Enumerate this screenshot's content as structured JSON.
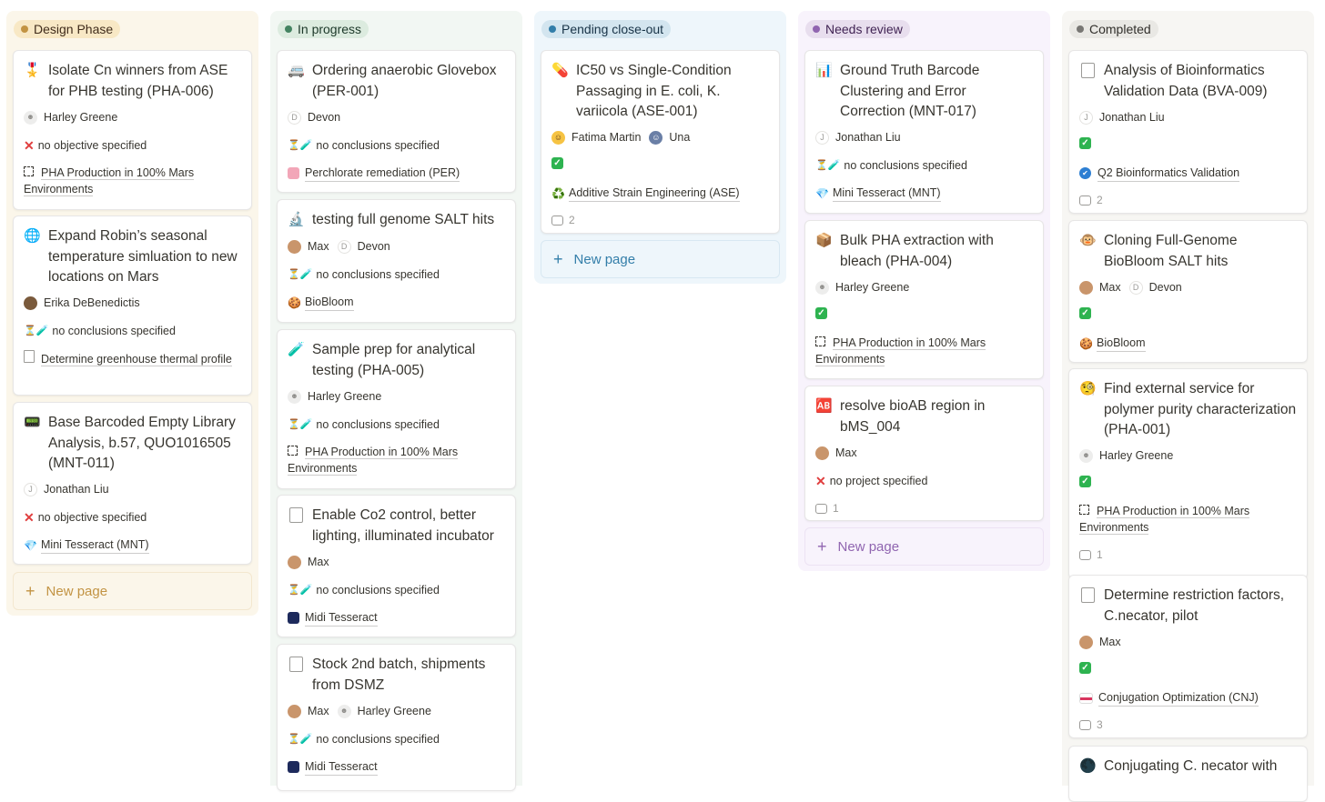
{
  "colors": {
    "design_bg": "#fbf6ea",
    "design_pill": "#f8e8c5",
    "design_dot": "#c29343",
    "design_text": "#402c1b",
    "design_new": "#c29343",
    "progress_bg": "#f2f7f3",
    "progress_pill": "#dcebdf",
    "progress_dot": "#448361",
    "progress_text": "#1c3829",
    "pending_bg": "#eef6fb",
    "pending_pill": "#d3e5ef",
    "pending_dot": "#337ea9",
    "pending_text": "#183347",
    "pending_new": "#337ea9",
    "review_bg": "#f8f3fc",
    "review_pill": "#e8deee",
    "review_dot": "#9065b0",
    "review_text": "#412454",
    "review_new": "#9065b0",
    "done_bg": "#f7f6f3",
    "done_pill": "#e9e8e4",
    "done_dot": "#787774",
    "done_text": "#32302c"
  },
  "columns": {
    "design": {
      "label": "Design Phase",
      "new_page": "New page",
      "cards": [
        {
          "icon": "🎖️",
          "title": "Isolate Cn winners from ASE for PHB testing (PHA-006)",
          "person": "Harley Greene",
          "status": "no objective specified",
          "link": "PHA Production in 100% Mars Environments"
        },
        {
          "icon": "🌐",
          "title": "Expand Robin’s seasonal temperature simluation to new locations on Mars",
          "person": "Erika DeBenedictis",
          "status": "no conclusions specified",
          "link": "Determine greenhouse thermal profile"
        },
        {
          "icon": "📟",
          "title": "Base Barcoded Empty Library Analysis, b.57, QUO1016505 (MNT-011)",
          "person": "Jonathan Liu",
          "person_initial": "J",
          "status": "no objective specified",
          "link": "Mini Tesseract (MNT)"
        }
      ]
    },
    "progress": {
      "label": "In progress",
      "cards": [
        {
          "icon": "🚐",
          "title": "Ordering anaerobic Glovebox (PER-001)",
          "person": "Devon",
          "person_initial": "D",
          "status": "no conclusions specified",
          "link": "Perchlorate remediation (PER)"
        },
        {
          "icon": "🔬",
          "title": "testing full genome SALT hits",
          "person1": "Max",
          "person2": "Devon",
          "person2_initial": "D",
          "status": "no conclusions specified",
          "link": "BioBloom"
        },
        {
          "icon": "🧪",
          "title": "Sample prep for analytical testing (PHA-005)",
          "person": "Harley Greene",
          "status": "no conclusions specified",
          "link": "PHA Production in 100% Mars Environments"
        },
        {
          "title": "Enable Co2 control, better lighting, illuminated incubator",
          "person": "Max",
          "status": "no conclusions specified",
          "link": "Midi Tesseract"
        },
        {
          "title": "Stock 2nd batch, shipments from DSMZ",
          "person1": "Max",
          "person2": "Harley Greene",
          "status": "no conclusions specified",
          "link": "Midi Tesseract"
        }
      ]
    },
    "pending": {
      "label": "Pending close-out",
      "new_page": "New page",
      "cards": [
        {
          "icon": "💊",
          "title": "IC50 vs Single-Condition Passaging  in E. coli, K. variicola (ASE-001)",
          "person1": "Fatima Martin",
          "person2": "Una",
          "link": "Additive Strain Engineering (ASE)",
          "comments": "2"
        }
      ]
    },
    "review": {
      "label": "Needs review",
      "new_page": "New page",
      "cards": [
        {
          "icon": "📊",
          "title": "Ground Truth Barcode Clustering and Error Correction (MNT-017)",
          "person": "Jonathan Liu",
          "person_initial": "J",
          "status": "no conclusions specified",
          "link": "Mini Tesseract (MNT)"
        },
        {
          "icon": "📦",
          "title": "Bulk PHA extraction with bleach (PHA-004)",
          "person": "Harley Greene",
          "link": "PHA Production in 100% Mars Environments"
        },
        {
          "icon": "🆎",
          "title": "resolve bioAB region in bMS_004",
          "person": "Max",
          "status": "no project specified",
          "comments": "1"
        }
      ]
    },
    "done": {
      "label": "Completed",
      "cards": [
        {
          "title": "Analysis of Bioinformatics Validation Data (BVA-009)",
          "person": "Jonathan Liu",
          "person_initial": "J",
          "link": "Q2 Bioinformatics Validation",
          "comments": "2"
        },
        {
          "icon": "🐵",
          "title": "Cloning Full-Genome BioBloom SALT hits",
          "person1": "Max",
          "person2": "Devon",
          "person2_initial": "D",
          "link": "BioBloom"
        },
        {
          "icon": "🧐",
          "title": "Find external service for polymer purity characterization (PHA-001)",
          "person": "Harley Greene",
          "link": "PHA Production in 100% Mars Environments",
          "comments": "1"
        },
        {
          "title": "Determine restriction factors, C.necator, pilot",
          "person": "Max",
          "link": "Conjugation Optimization (CNJ)",
          "comments": "3"
        },
        {
          "icon": "🌑",
          "title": "Conjugating C. necator with"
        }
      ]
    }
  },
  "icons": {
    "hourglass_tube": "⏳🧪",
    "recycle": "♻️",
    "gem": "💎",
    "cookie": "🍪",
    "verified": "✔",
    "check": "✓",
    "x": "✕",
    "plus": "+"
  }
}
